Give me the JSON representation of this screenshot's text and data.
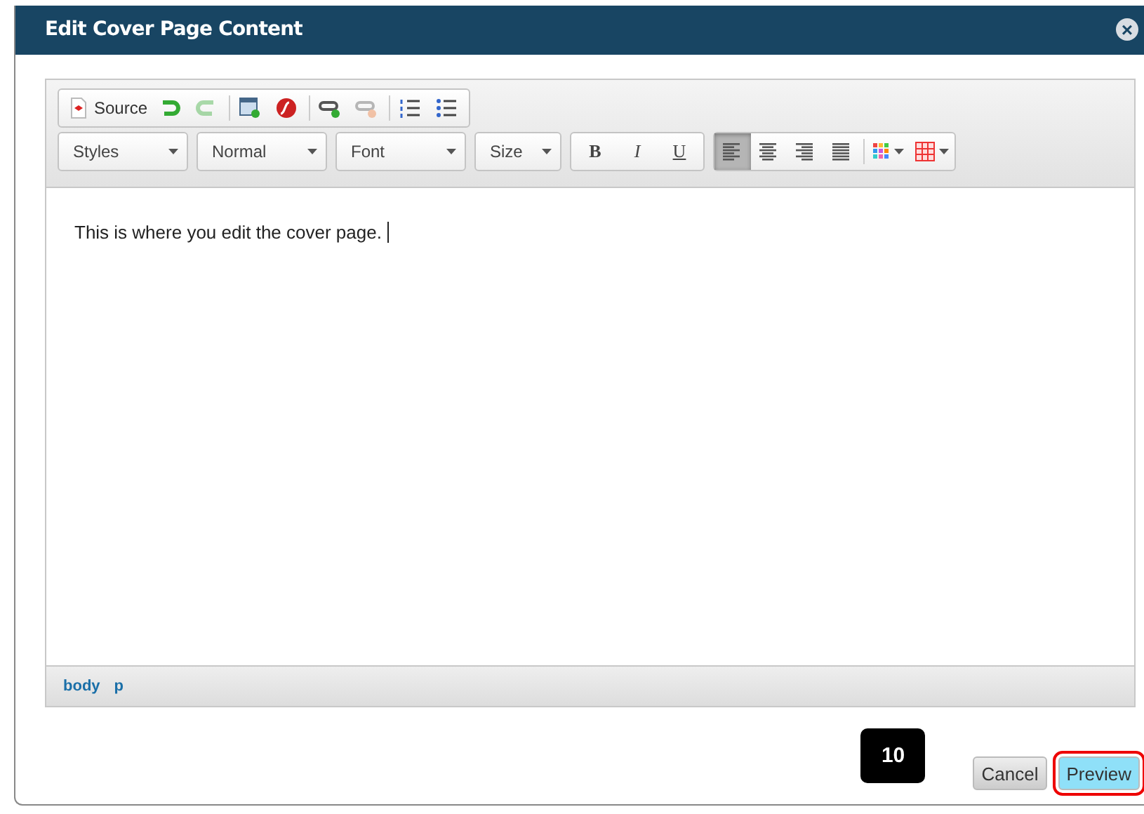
{
  "dialog": {
    "title": "Edit Cover Page Content",
    "close_label": "×"
  },
  "toolbar": {
    "row_1": [
      {
        "kind": "source",
        "label": "Source",
        "disabled": false
      },
      {
        "kind": "undo",
        "disabled": false
      },
      {
        "kind": "redo",
        "disabled": true
      },
      {
        "kind": "sep"
      },
      {
        "kind": "image",
        "disabled": false
      },
      {
        "kind": "flash",
        "disabled": false
      },
      {
        "kind": "sep"
      },
      {
        "kind": "link",
        "disabled": false
      },
      {
        "kind": "unlink",
        "disabled": true
      },
      {
        "kind": "sep"
      },
      {
        "kind": "numbered-list",
        "disabled": false
      },
      {
        "kind": "bulleted-list",
        "disabled": false
      }
    ],
    "combos": [
      {
        "label": "Styles"
      },
      {
        "label": "Normal"
      },
      {
        "label": "Font"
      },
      {
        "label": "Size"
      }
    ],
    "format": [
      {
        "label": "B",
        "kind": "bold"
      },
      {
        "label": "I",
        "kind": "italic"
      },
      {
        "label": "U",
        "kind": "underline"
      }
    ],
    "align": [
      {
        "kind": "left",
        "selected": true
      },
      {
        "kind": "center",
        "selected": false
      },
      {
        "kind": "right",
        "selected": false
      },
      {
        "kind": "justify",
        "selected": false
      }
    ],
    "extras": [
      {
        "kind": "color"
      },
      {
        "kind": "table"
      }
    ]
  },
  "content": {
    "text": "This is where you edit the cover page."
  },
  "path": [
    {
      "label": "body"
    },
    {
      "label": "p"
    }
  ],
  "page_badge": "10",
  "buttons": [
    {
      "label": "Cancel",
      "highlighted": false
    },
    {
      "label": "Preview",
      "highlighted": true
    }
  ]
}
